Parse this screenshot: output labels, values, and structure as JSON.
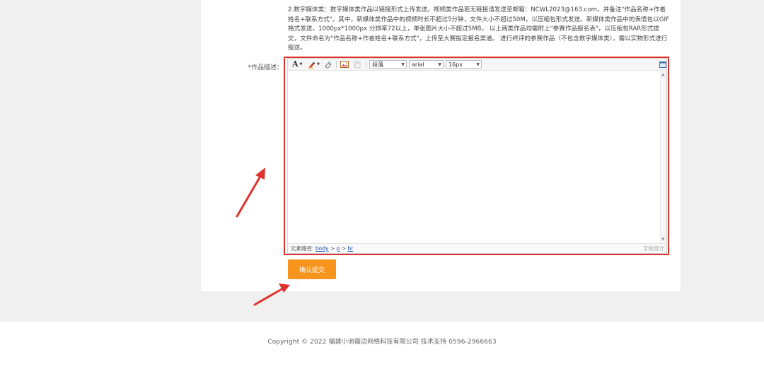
{
  "notice": {
    "text": "2.数字媒体类：数字媒体类作品以链接形式上传发送。视频类作品若无链接请发送至邮箱：NCWL2023@163.com，并备注\"作品名称+作者姓名+联系方式\"。其中，新媒体类作品中的视频时长不超过5分钟，文件大小不超过50M，以压缩包形式发送。新媒体类作品中的表情包以GIF格式发送，1000px*1000px 分辨率72以上，单张图片大小不超过5MB。 以上两类作品均需附上\"参赛作品报名表\"，以压缩包RAR形式提交，文件命名为\"作品名称+作者姓名+联系方式\"，上传至大赛指定报名渠道。 进行终评的参赛作品（不包含数字媒体类），需以实物形式进行报送。"
  },
  "form": {
    "description_label": "*作品描述："
  },
  "editor": {
    "toolbar": {
      "font_color_glyph": "A",
      "paragraph_value": "段落",
      "font_family_value": "arial",
      "font_size_value": "16px"
    },
    "statusbar": {
      "path_label": "元素路径:",
      "path": [
        "body",
        "p",
        "br"
      ],
      "word_count_label": "字数统计"
    }
  },
  "submit": {
    "label": "确认提交"
  },
  "footer": {
    "copyright": "Copyright © 2022 福建小池瓣边网络科技有限公司 技术支持 0596-2966663"
  },
  "colors": {
    "highlight": "#e0322d",
    "button": "#f7941d",
    "link": "#1a4fb5"
  }
}
